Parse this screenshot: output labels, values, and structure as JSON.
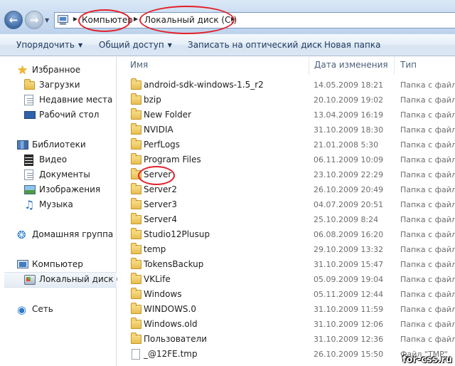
{
  "address": {
    "crumbs": [
      "Компьютер",
      "Локальный диск (C:)"
    ]
  },
  "toolbar": {
    "organize": "Упорядочить",
    "share": "Общий доступ",
    "burn": "Записать на оптический диск",
    "new_folder": "Новая папка"
  },
  "nav": {
    "favorites": "Избранное",
    "downloads": "Загрузки",
    "recent": "Недавние места",
    "desktop": "Рабочий стол",
    "libraries": "Библиотеки",
    "video": "Видео",
    "documents": "Документы",
    "pictures": "Изображения",
    "music": "Музыка",
    "homegroup": "Домашняя группа",
    "computer": "Компьютер",
    "local_disk": "Локальный диск (C",
    "network": "Сеть"
  },
  "columns": {
    "name": "Имя",
    "date": "Дата изменения",
    "type": "Тип"
  },
  "files": [
    {
      "name": "android-sdk-windows-1.5_r2",
      "date": "14.05.2009 18:21",
      "type": "Папка с файл",
      "kind": "folder"
    },
    {
      "name": "bzip",
      "date": "20.10.2009 19:02",
      "type": "Папка с файл",
      "kind": "folder"
    },
    {
      "name": "New Folder",
      "date": "13.04.2009 16:19",
      "type": "Папка с файл",
      "kind": "folder"
    },
    {
      "name": "NVIDIA",
      "date": "31.10.2009 18:30",
      "type": "Папка с файл",
      "kind": "folder"
    },
    {
      "name": "PerfLogs",
      "date": "21.01.2008 5:30",
      "type": "Папка с файл",
      "kind": "folder"
    },
    {
      "name": "Program Files",
      "date": "06.11.2009 10:09",
      "type": "Папка с файл",
      "kind": "folder"
    },
    {
      "name": "Server",
      "date": "23.10.2009 22:29",
      "type": "Папка с файл",
      "kind": "folder"
    },
    {
      "name": "Server2",
      "date": "26.10.2009 20:49",
      "type": "Папка с файл",
      "kind": "folder"
    },
    {
      "name": "Server3",
      "date": "04.07.2009 20:51",
      "type": "Папка с файл",
      "kind": "folder"
    },
    {
      "name": "Server4",
      "date": "25.10.2009 8:24",
      "type": "Папка с файл",
      "kind": "folder"
    },
    {
      "name": "Studio12Plusup",
      "date": "06.08.2009 16:20",
      "type": "Папка с файл",
      "kind": "folder"
    },
    {
      "name": "temp",
      "date": "29.10.2009 13:32",
      "type": "Папка с файл",
      "kind": "folder"
    },
    {
      "name": "TokensBackup",
      "date": "31.10.2009 15:47",
      "type": "Папка с файл",
      "kind": "folder"
    },
    {
      "name": "VKLife",
      "date": "05.09.2009 19:04",
      "type": "Папка с файл",
      "kind": "folder"
    },
    {
      "name": "Windows",
      "date": "05.11.2009 12:44",
      "type": "Папка с файл",
      "kind": "folder"
    },
    {
      "name": "WINDOWS.0",
      "date": "31.10.2009 11:59",
      "type": "Папка с файл",
      "kind": "folder"
    },
    {
      "name": "Windows.old",
      "date": "31.10.2009 12:06",
      "type": "Папка с файл",
      "kind": "folder"
    },
    {
      "name": "Пользователи",
      "date": "31.10.2009 12:36",
      "type": "Папка с файл",
      "kind": "folder"
    },
    {
      "name": "_@12FE.tmp",
      "date": "26.10.2009 15:50",
      "type": "Файл \"TMP\"",
      "kind": "file"
    }
  ],
  "watermark": "for-css.ru"
}
